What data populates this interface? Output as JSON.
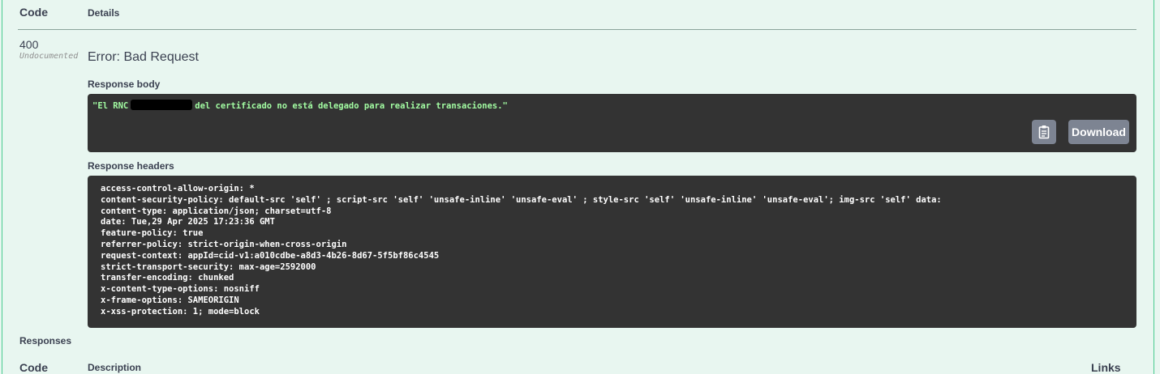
{
  "table_header": {
    "code": "Code",
    "details": "Details"
  },
  "response": {
    "status_code": "400",
    "undocumented": "Undocumented",
    "error_title": "Error: Bad Request",
    "body_label": "Response body",
    "body_text_prefix": "\"El RNC",
    "body_text_suffix": "del certificado no está delegado para realizar transaciones.\"",
    "download_label": "Download",
    "headers_label": "Response headers",
    "headers": [
      "access-control-allow-origin: *",
      "content-security-policy: default-src 'self' ; script-src 'self' 'unsafe-inline' 'unsafe-eval' ; style-src 'self' 'unsafe-inline' 'unsafe-eval'; img-src 'self' data:",
      "content-type: application/json; charset=utf-8",
      "date: Tue,29 Apr 2025 17:23:36 GMT",
      "feature-policy: true",
      "referrer-policy: strict-origin-when-cross-origin",
      "request-context: appId=cid-v1:a010cdbe-a8d3-4b26-8d67-5f5bf86c4545",
      "strict-transport-security: max-age=2592000",
      "transfer-encoding: chunked",
      "x-content-type-options: nosniff",
      "x-frame-options: SAMEORIGIN",
      "x-xss-protection: 1; mode=block"
    ]
  },
  "responses_section": {
    "title": "Responses",
    "code": "Code",
    "description": "Description",
    "links": "Links"
  },
  "icons": {
    "copy": "clipboard-copy-icon"
  },
  "colors": {
    "background": "#e8f6f0",
    "border": "#49cc90",
    "code_block": "#333333",
    "body_text": "#a2fca2",
    "button": "#7d8492"
  }
}
